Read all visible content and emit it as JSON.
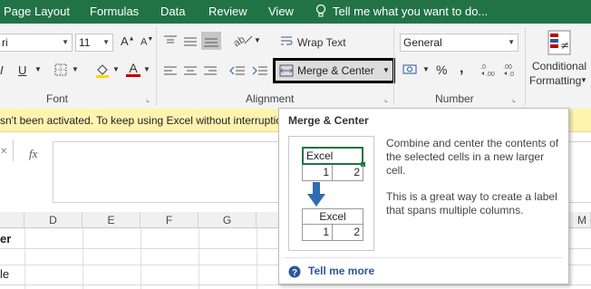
{
  "menu": {
    "tabs": [
      "Page Layout",
      "Formulas",
      "Data",
      "Review",
      "View"
    ],
    "tell_me": "Tell me what you want to do..."
  },
  "font_group": {
    "font_name": "ri",
    "font_size": "11",
    "bold": "B",
    "italic": "I",
    "underline": "U",
    "font_color_letter": "A",
    "grow_font": "A",
    "shrink_font": "A",
    "label": "Font"
  },
  "alignment_group": {
    "wrap_text": "Wrap Text",
    "merge_center": "Merge & Center",
    "label": "Alignment"
  },
  "number_group": {
    "format": "General",
    "percent": "%",
    "comma": ",",
    "label": "Number"
  },
  "styles_group": {
    "conditional": "Conditional",
    "formatting": "Formatting"
  },
  "notice": {
    "text": "sn't been activated. To keep using Excel without interruptio"
  },
  "formula_bar": {
    "fx": "fx"
  },
  "grid": {
    "columns": [
      "D",
      "E",
      "F",
      "G",
      "M"
    ],
    "cells": [
      "er",
      "le"
    ]
  },
  "tooltip": {
    "title": "Merge & Center",
    "desc1": "Combine and center the contents of the selected cells in a new larger cell.",
    "desc2": "This is a great way to create a label that spans multiple columns.",
    "illus_top_text": "Excel",
    "illus_top_n1": "1",
    "illus_top_n2": "2",
    "illus_bottom_text": "Excel",
    "illus_bottom_n1": "1",
    "illus_bottom_n2": "2",
    "tell_more": "Tell me more"
  },
  "colors": {
    "menubar": "#217346",
    "notice": "#fff3b0",
    "link": "#2b579a",
    "accent_red": "#c00000",
    "accent_yellow": "#ffd700"
  }
}
